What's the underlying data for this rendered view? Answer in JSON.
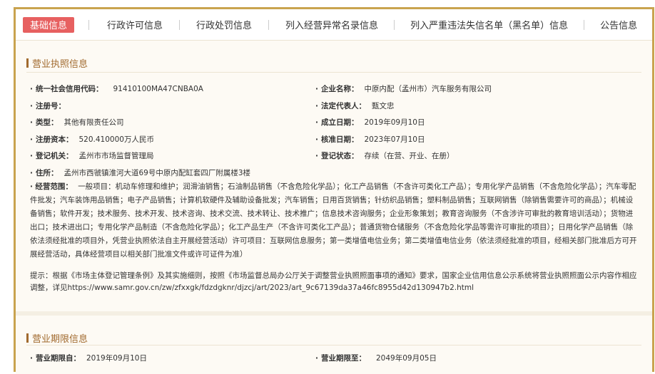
{
  "tabs": [
    {
      "label": "基础信息",
      "active": true
    },
    {
      "label": "行政许可信息"
    },
    {
      "label": "行政处罚信息"
    },
    {
      "label": "列入经营异常名录信息"
    },
    {
      "label": "列入严重违法失信名单（黑名单）信息"
    },
    {
      "label": "公告信息"
    }
  ],
  "license": {
    "title": "营业执照信息",
    "credit_code": {
      "label": "统一社会信用代码：",
      "value": "91410100MA47CNBA0A"
    },
    "company_name": {
      "label": "企业名称：",
      "value": "中原内配（孟州市）汽车服务有限公司"
    },
    "reg_no": {
      "label": "注册号：",
      "value": ""
    },
    "legal_rep": {
      "label": "法定代表人：",
      "value": "甄文忠"
    },
    "type": {
      "label": "类型：",
      "value": "其他有限责任公司"
    },
    "established": {
      "label": "成立日期：",
      "value": "2019年09月10日"
    },
    "capital": {
      "label": "注册资本：",
      "value": "520.410000万人民币"
    },
    "approved": {
      "label": "核准日期：",
      "value": "2023年07月10日"
    },
    "authority": {
      "label": "登记机关：",
      "value": "孟州市市场监督管理局"
    },
    "status": {
      "label": "登记状态：",
      "value": "存续（在营、开业、在册）"
    },
    "address": {
      "label": "住所：",
      "value": "孟州市西虢镇淮河大道69号中原内配缸套四厂附属楼3楼"
    },
    "scope": {
      "label": "经营范围：",
      "value": "一般项目：机动车修理和维护；润滑油销售；石油制品销售（不含危险化学品）；化工产品销售（不含许可类化工产品）；专用化学产品销售（不含危险化学品）；汽车零配件批发；汽车装饰用品销售；电子产品销售；计算机软硬件及辅助设备批发；汽车销售；日用百货销售；针纺织品销售；塑料制品销售；互联网销售（除销售需要许可的商品）；机械设备销售；软件开发；技术服务、技术开发、技术咨询、技术交流、技术转让、技术推广；信息技术咨询服务；企业形象策划；教育咨询服务（不含涉许可审批的教育培训活动）；货物进出口；技术进出口；专用化学产品制造（不含危险化学品）；化工产品生产（不含许可类化工产品）；普通货物仓储服务（不含危险化学品等需许可审批的项目）；日用化学产品销售（除依法须经批准的项目外，凭营业执照依法自主开展经营活动）许可项目：互联网信息服务；第一类增值电信业务；第二类增值电信业务（依法须经批准的项目，经相关部门批准后方可开展经营活动，具体经营项目以相关部门批准文件或许可证件为准）"
    },
    "hint": "提示：根据《市场主体登记管理条例》及其实施细则，按照《市场监督总局办公厅关于调整营业执照照面事项的通知》要求，国家企业信用信息公示系统将营业执照照面公示内容作相应调整，详见https://www.samr.gov.cn/zw/zfxxgk/fdzdgknr/djzcj/art/2023/art_9c67139da37a46fc8955d42d130947b2.html"
  },
  "period": {
    "title": "营业期限信息",
    "from": {
      "label": "营业期限自：",
      "value": "2019年09月10日"
    },
    "to": {
      "label": "营业期限至：",
      "value": "2049年09月05日"
    }
  }
}
